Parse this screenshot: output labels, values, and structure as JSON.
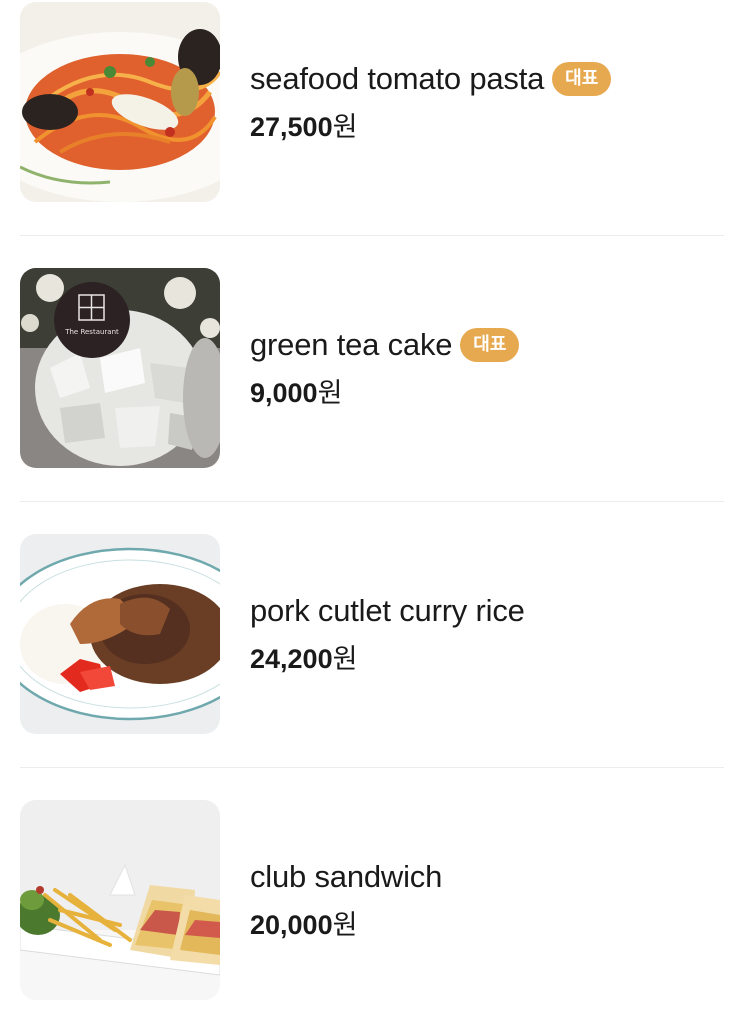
{
  "menu": {
    "items": [
      {
        "name": "seafood tomato pasta",
        "badge": "대표",
        "price": "27,500",
        "unit": "원",
        "photo": "seafood-pasta"
      },
      {
        "name": "green tea cake",
        "badge": "대표",
        "price": "9,000",
        "unit": "원",
        "photo": "green-tea-cake",
        "photo_logo_text": "The Restaurant"
      },
      {
        "name": "pork cutlet curry rice",
        "price": "24,200",
        "unit": "원",
        "photo": "pork-cutlet-curry"
      },
      {
        "name": "club sandwich",
        "price": "20,000",
        "unit": "원",
        "photo": "club-sandwich"
      }
    ]
  },
  "colors": {
    "badge_bg": "#e7a94f",
    "divider": "#ececec",
    "text": "#1a1a1a"
  }
}
